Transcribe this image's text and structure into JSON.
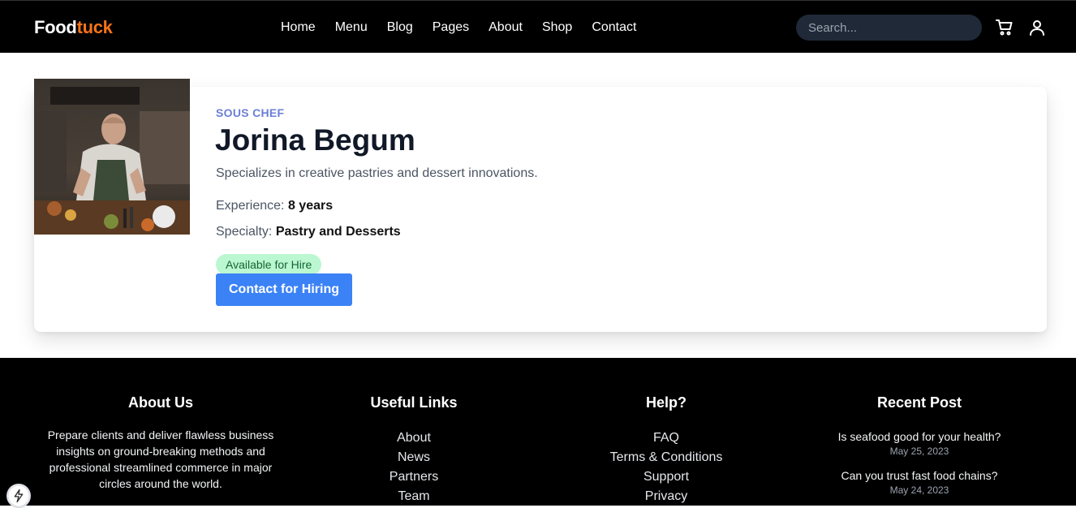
{
  "header": {
    "logo_main": "Food",
    "logo_accent": "tuck",
    "nav": [
      "Home",
      "Menu",
      "Blog",
      "Pages",
      "About",
      "Shop",
      "Contact"
    ],
    "search_placeholder": "Search...",
    "accent_color": "#f97316"
  },
  "profile": {
    "role": "SOUS CHEF",
    "name": "Jorina Begum",
    "description": "Specializes in creative pastries and dessert innovations.",
    "experience_label": "Experience:",
    "experience_value": "8 years",
    "specialty_label": "Specialty:",
    "specialty_value": "Pastry and Desserts",
    "status_badge": "Available for Hire",
    "hire_button": "Contact for Hiring",
    "button_color": "#3b82f6"
  },
  "footer": {
    "about_title": "About Us",
    "about_text": "Prepare clients and deliver flawless business insights on ground-breaking methods and professional streamlined commerce in major circles around the world.",
    "useful_title": "Useful Links",
    "useful_links": [
      "About",
      "News",
      "Partners",
      "Team"
    ],
    "help_title": "Help?",
    "help_links": [
      "FAQ",
      "Terms & Conditions",
      "Support",
      "Privacy"
    ],
    "recent_title": "Recent Post",
    "posts": [
      {
        "title": "Is seafood good for your health?",
        "date": "May 25, 2023"
      },
      {
        "title": "Can you trust fast food chains?",
        "date": "May 24, 2023"
      }
    ]
  }
}
